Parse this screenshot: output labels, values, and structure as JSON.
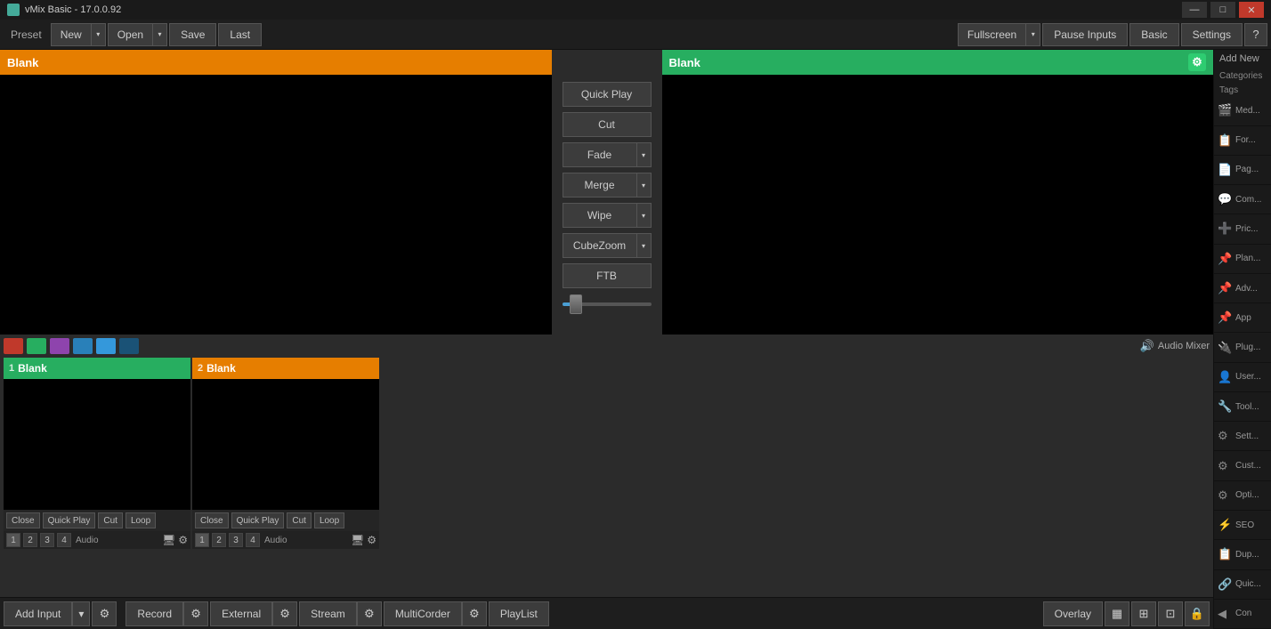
{
  "titleBar": {
    "title": "vMix Basic - 17.0.0.92",
    "minimizeLabel": "—",
    "maximizeLabel": "□",
    "closeLabel": "✕"
  },
  "toolbar": {
    "presetLabel": "Preset",
    "newLabel": "New",
    "openLabel": "Open",
    "saveLabel": "Save",
    "lastLabel": "Last",
    "fullscreenLabel": "Fullscreen",
    "pauseInputsLabel": "Pause Inputs",
    "basicLabel": "Basic",
    "settingsLabel": "Settings",
    "helpLabel": "?"
  },
  "preview": {
    "title": "Blank"
  },
  "program": {
    "title": "Blank",
    "gearIcon": "⚙"
  },
  "transitions": {
    "quickPlay": "Quick Play",
    "cut": "Cut",
    "fade": "Fade",
    "merge": "Merge",
    "wipe": "Wipe",
    "cubeZoom": "CubeZoom",
    "ftb": "FTB"
  },
  "colors": {
    "red": "#c0392b",
    "green": "#27ae60",
    "purple": "#8e44ad",
    "blue": "#2980b9",
    "lightBlue": "#3498db",
    "darkBlue": "#1a5276"
  },
  "audioMixer": {
    "label": "Audio Mixer",
    "icon": "🔊"
  },
  "inputCards": [
    {
      "num": "1",
      "title": "Blank",
      "headerClass": "green",
      "controls": [
        "Close",
        "Quick Play",
        "Cut",
        "Loop"
      ],
      "numbers": [
        "1",
        "2",
        "3",
        "4"
      ],
      "audioLabel": "Audio"
    },
    {
      "num": "2",
      "title": "Blank",
      "headerClass": "orange",
      "controls": [
        "Close",
        "Quick Play",
        "Cut",
        "Loop"
      ],
      "numbers": [
        "1",
        "2",
        "3",
        "4"
      ],
      "audioLabel": "Audio"
    }
  ],
  "bottomBar": {
    "addInput": "Add Input",
    "addInputArrow": "▾",
    "gearIcon": "⚙",
    "record": "Record",
    "recordGear": "⚙",
    "external": "External",
    "externalGear": "⚙",
    "stream": "Stream",
    "streamGear": "⚙",
    "multiCorder": "MultiCorder",
    "multiCorderGear": "⚙",
    "playList": "PlayList",
    "overlay": "Overlay",
    "overlayIcons": [
      "▦",
      "⊞",
      "⊡",
      "🔒"
    ]
  },
  "rightSidebar": {
    "addNewLabel": "Add New",
    "categories": "Categories",
    "tags": "Tags",
    "items": [
      {
        "icon": "🎬",
        "label": "Media"
      },
      {
        "icon": "📋",
        "label": "Forms"
      },
      {
        "icon": "📄",
        "label": "Pages"
      },
      {
        "icon": "💬",
        "label": "Com..."
      },
      {
        "icon": "➕",
        "label": "Pricin"
      },
      {
        "icon": "📌",
        "label": "Plans"
      },
      {
        "icon": "📌",
        "label": "Adva..."
      },
      {
        "icon": "📌",
        "label": "App"
      },
      {
        "icon": "🔌",
        "label": "Plug..."
      },
      {
        "icon": "👤",
        "label": "Users"
      },
      {
        "icon": "🔧",
        "label": "Tools"
      },
      {
        "icon": "⚙",
        "label": "Setti..."
      },
      {
        "icon": "⚙",
        "label": "Cust..."
      },
      {
        "icon": "⚙",
        "label": "Optio..."
      },
      {
        "icon": "⚡",
        "label": "SEO"
      },
      {
        "icon": "📋",
        "label": "Dup..."
      },
      {
        "icon": "🔗",
        "label": "Quic..."
      },
      {
        "icon": "◀",
        "label": "Con"
      }
    ]
  }
}
